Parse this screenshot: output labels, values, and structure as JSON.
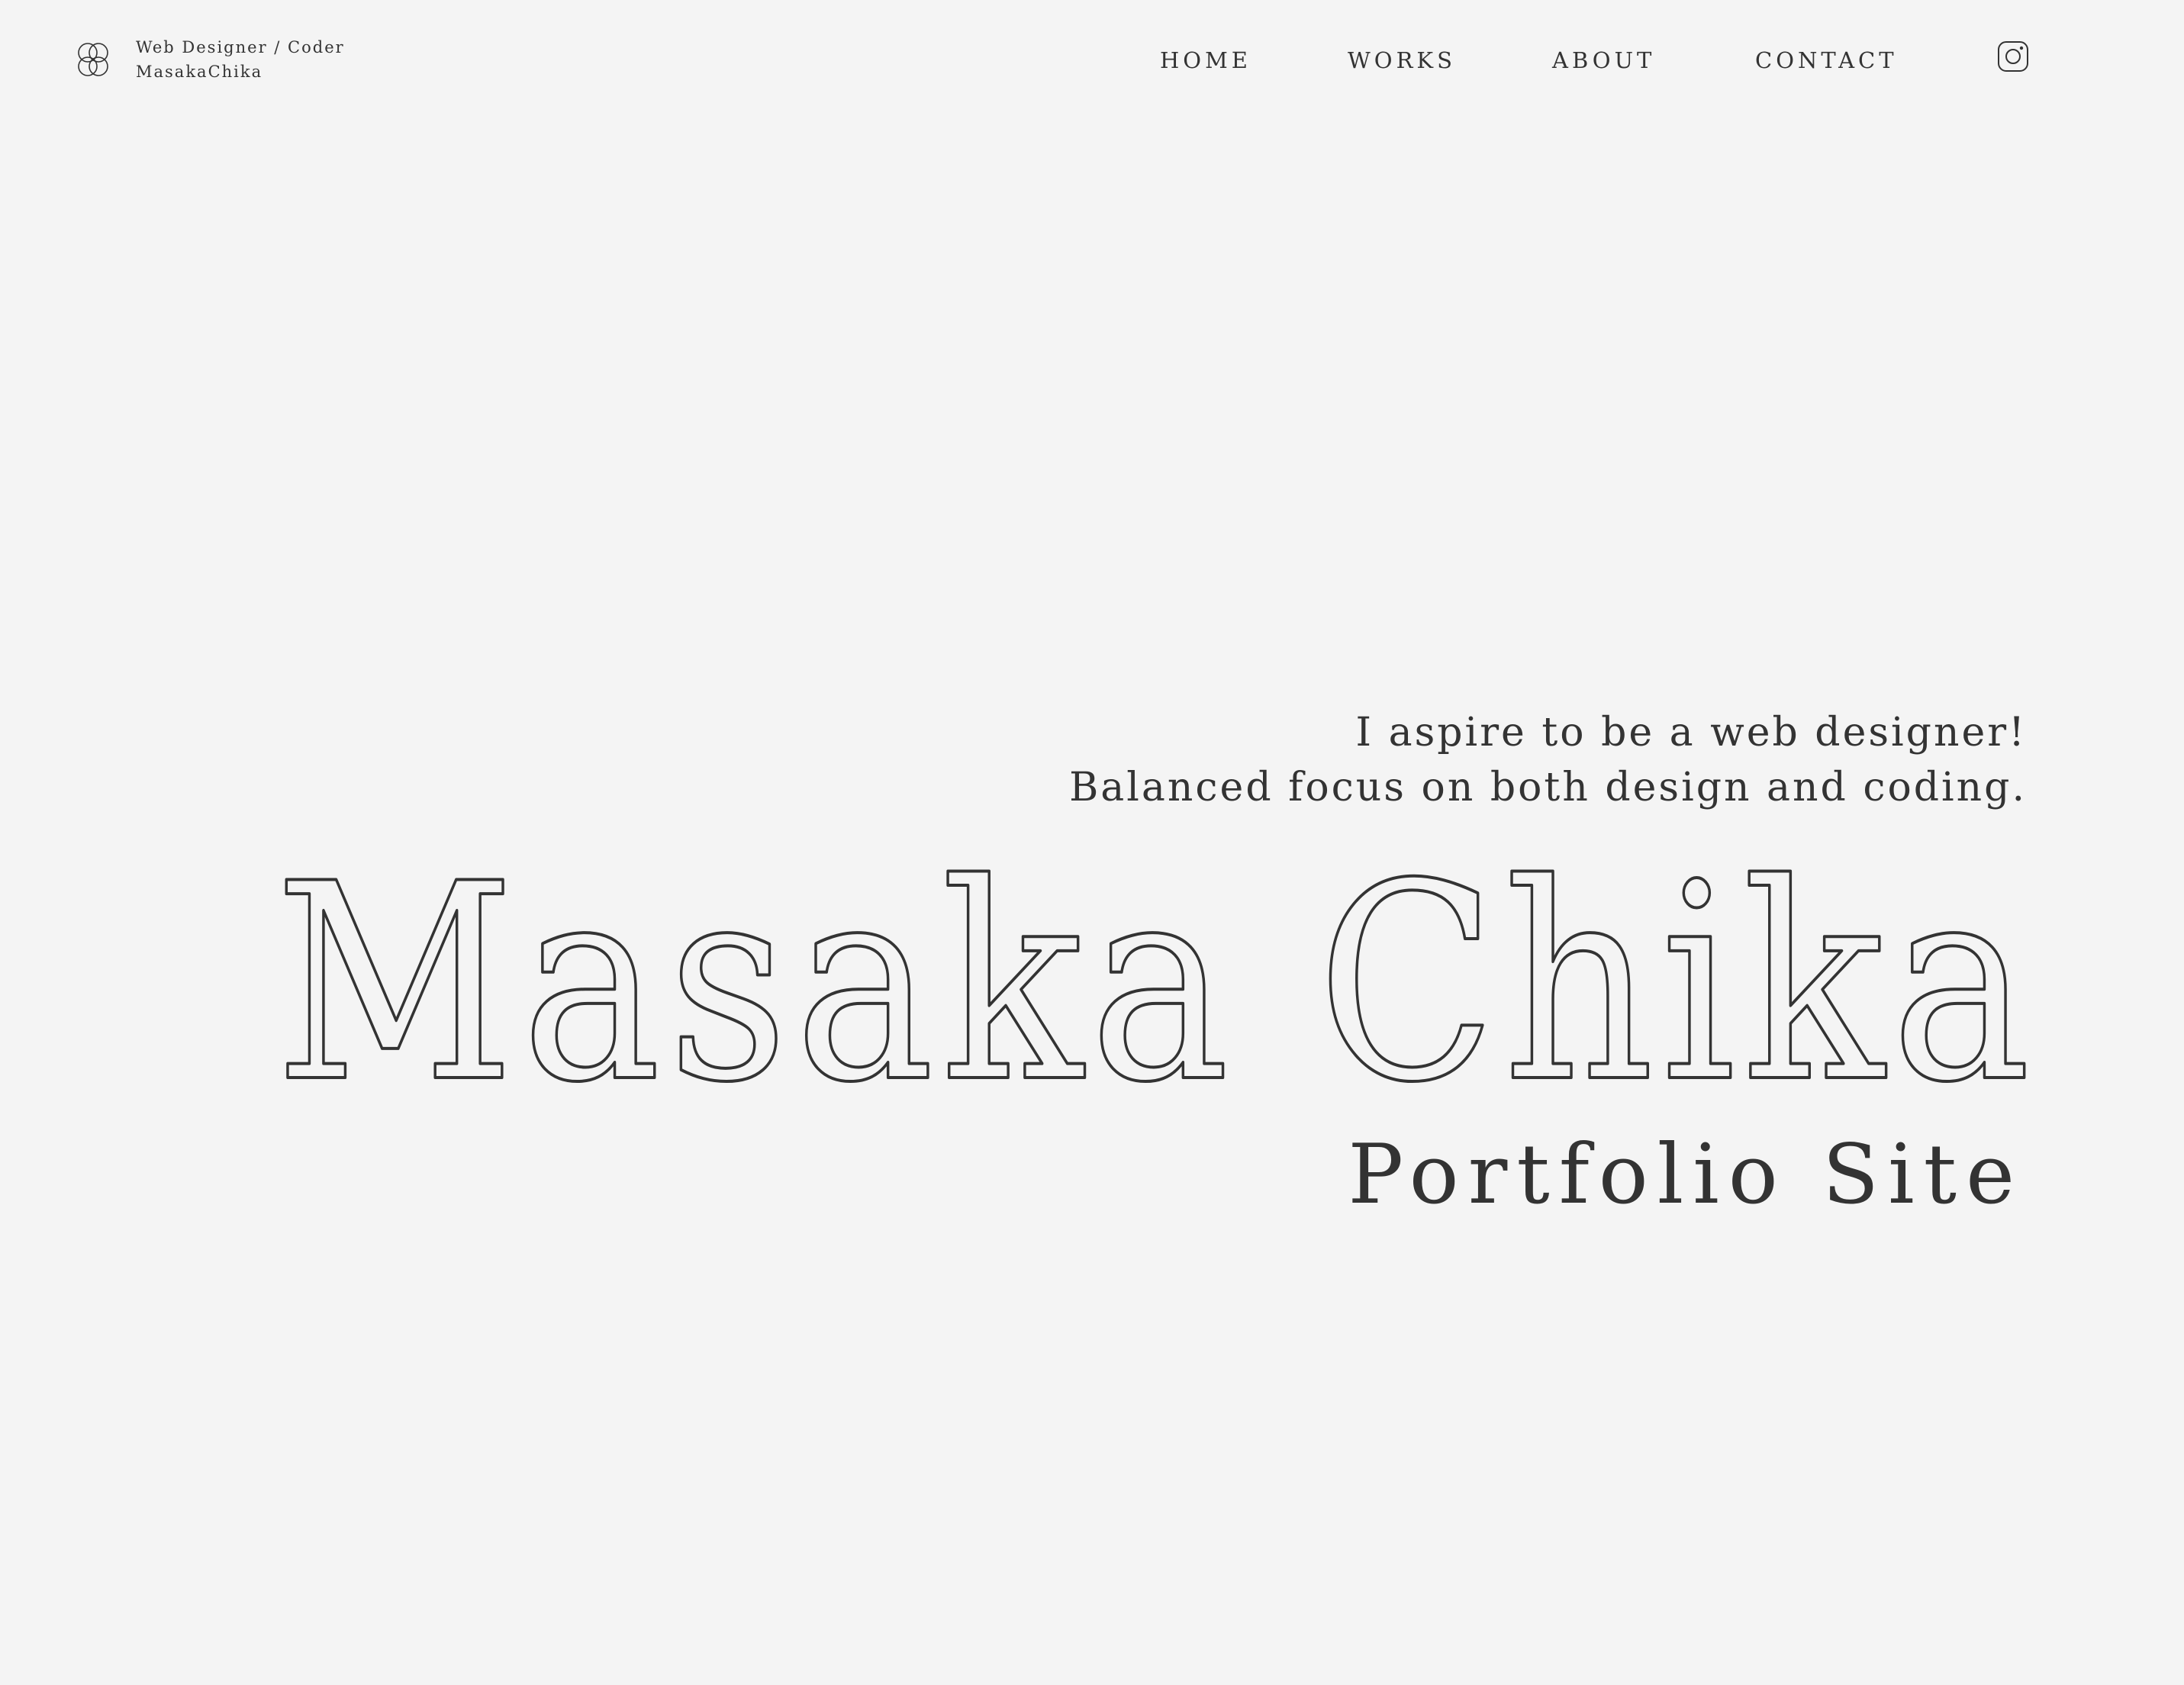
{
  "brand": {
    "role": "Web Designer / Coder",
    "name": "MasakaChika",
    "logo_icon": "overlapping-circles-logo-icon"
  },
  "nav": {
    "items": [
      {
        "label": "HOME"
      },
      {
        "label": "WORKS"
      },
      {
        "label": "ABOUT"
      },
      {
        "label": "CONTACT"
      }
    ],
    "social_icon": "instagram-icon"
  },
  "hero": {
    "tagline_line1": "I aspire to be a web designer!",
    "tagline_line2": "Balanced focus on both design and coding.",
    "name": "Masaka Chika",
    "subtitle": "Portfolio Site"
  },
  "colors": {
    "background": "#f4f4f4",
    "text": "#333333"
  }
}
